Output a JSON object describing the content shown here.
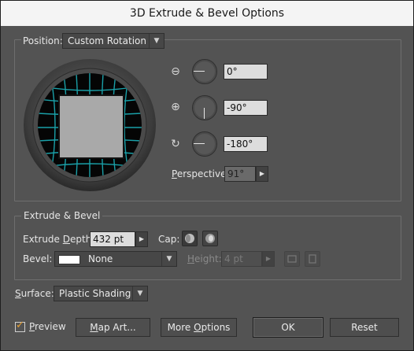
{
  "window": {
    "title": "3D Extrude & Bevel Options"
  },
  "position": {
    "label_prefix": "Position",
    "label_suffix": ":",
    "label_underline_char": "",
    "dropdown_value": "Custom Rotation",
    "x_rotation": "0°",
    "y_rotation": "-90°",
    "z_rotation": "-180°",
    "perspective_label": "Perspective:",
    "perspective_underline": "P",
    "perspective_rest": "erspective:",
    "perspective_value": "91°"
  },
  "extrude": {
    "group_title": "Extrude & Bevel",
    "depth_label_pre": "Extrude ",
    "depth_label_u": "D",
    "depth_label_post": "epth:",
    "depth_value": "432 pt",
    "cap_label": "Cap:",
    "bevel_label": "Bevel:",
    "bevel_value": "None",
    "height_label_u": "H",
    "height_label_post": "eight:",
    "height_value": "4 pt"
  },
  "surface": {
    "label_u": "S",
    "label_post": "urface:",
    "value": "Plastic Shading"
  },
  "footer": {
    "preview_u": "P",
    "preview_post": "review",
    "preview_checked": true,
    "map_art_u": "M",
    "map_art_post": "ap Art...",
    "more_options_pre": "More ",
    "more_options_u": "O",
    "more_options_post": "ptions",
    "ok_label": "OK",
    "reset_label": "Reset"
  },
  "colors": {
    "panel": "#535353",
    "grid": "#1aa0a8",
    "cube_face": "#a9a9a9"
  }
}
